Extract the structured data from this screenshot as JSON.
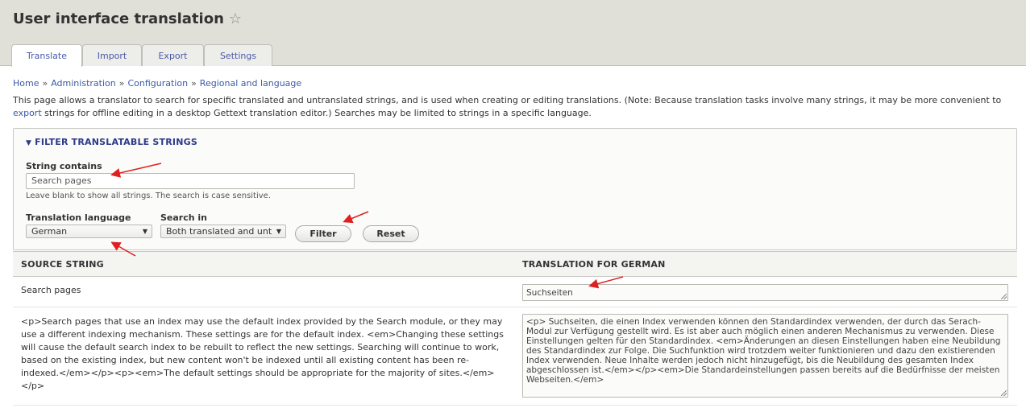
{
  "header": {
    "title": "User interface translation",
    "star_icon": "☆",
    "tabs": [
      {
        "label": "Translate",
        "active": true
      },
      {
        "label": "Import",
        "active": false
      },
      {
        "label": "Export",
        "active": false
      },
      {
        "label": "Settings",
        "active": false
      }
    ]
  },
  "breadcrumb": {
    "items": [
      "Home",
      "Administration",
      "Configuration",
      "Regional and language"
    ],
    "separator": "»"
  },
  "description": {
    "text_before_link": "This page allows a translator to search for specific translated and untranslated strings, and is used when creating or editing translations. (Note: Because translation tasks involve many strings, it may be more convenient to ",
    "link": "export",
    "text_after_link": " strings for offline editing in a desktop Gettext translation editor.) Searches may be limited to strings in a specific language."
  },
  "filter": {
    "legend": "FILTER TRANSLATABLE STRINGS",
    "legend_icon": "▼",
    "string_contains_label": "String contains",
    "string_contains_value": "Search pages",
    "string_contains_help": "Leave blank to show all strings. The search is case sensitive.",
    "language_label": "Translation language",
    "language_value": "German",
    "search_in_label": "Search in",
    "search_in_value": "Both translated and unt",
    "dropdown_icon": "▼",
    "filter_button": "Filter",
    "reset_button": "Reset"
  },
  "table": {
    "headers": [
      "SOURCE STRING",
      "TRANSLATION FOR GERMAN"
    ],
    "rows": [
      {
        "source": "Search pages",
        "translation": "Suchseiten"
      },
      {
        "source": "<p>Search pages that use an index may use the default index provided by the Search module, or they may use a different indexing mechanism. These settings are for the default index. <em>Changing these settings will cause the default search index to be rebuilt to reflect the new settings. Searching will continue to work, based on the existing index, but new content won't be indexed until all existing content has been re-indexed.</em></p><p><em>The default settings should be appropriate for the majority of sites.</em></p>",
        "translation": "<p> Suchseiten, die einen Index verwenden können den Standardindex verwenden, der durch das Serach-Modul zur Verfügung gestellt wird. Es ist aber auch möglich einen anderen Mechanismus zu verwenden. Diese Einstellungen gelten für den Standardindex. <em>Änderungen an diesen Einstellungen haben eine Neubildung des Standardindex zur Folge. Die Suchfunktion wird trotzdem weiter funktionieren und dazu den existierenden Index verwenden. Neue Inhalte werden jedoch nicht hinzugefügt, bis die Neubildung des gesamten Index abgeschlossen ist.</em></p><em>Die Standardeinstellungen passen bereits auf die Bedürfnisse der meisten Webseiten.</em>"
      }
    ]
  },
  "colors": {
    "link": "#3b5ba8",
    "legend": "#2b3a8a",
    "annotation_arrow": "#e02020",
    "header_bg": "#e0e0d8"
  }
}
